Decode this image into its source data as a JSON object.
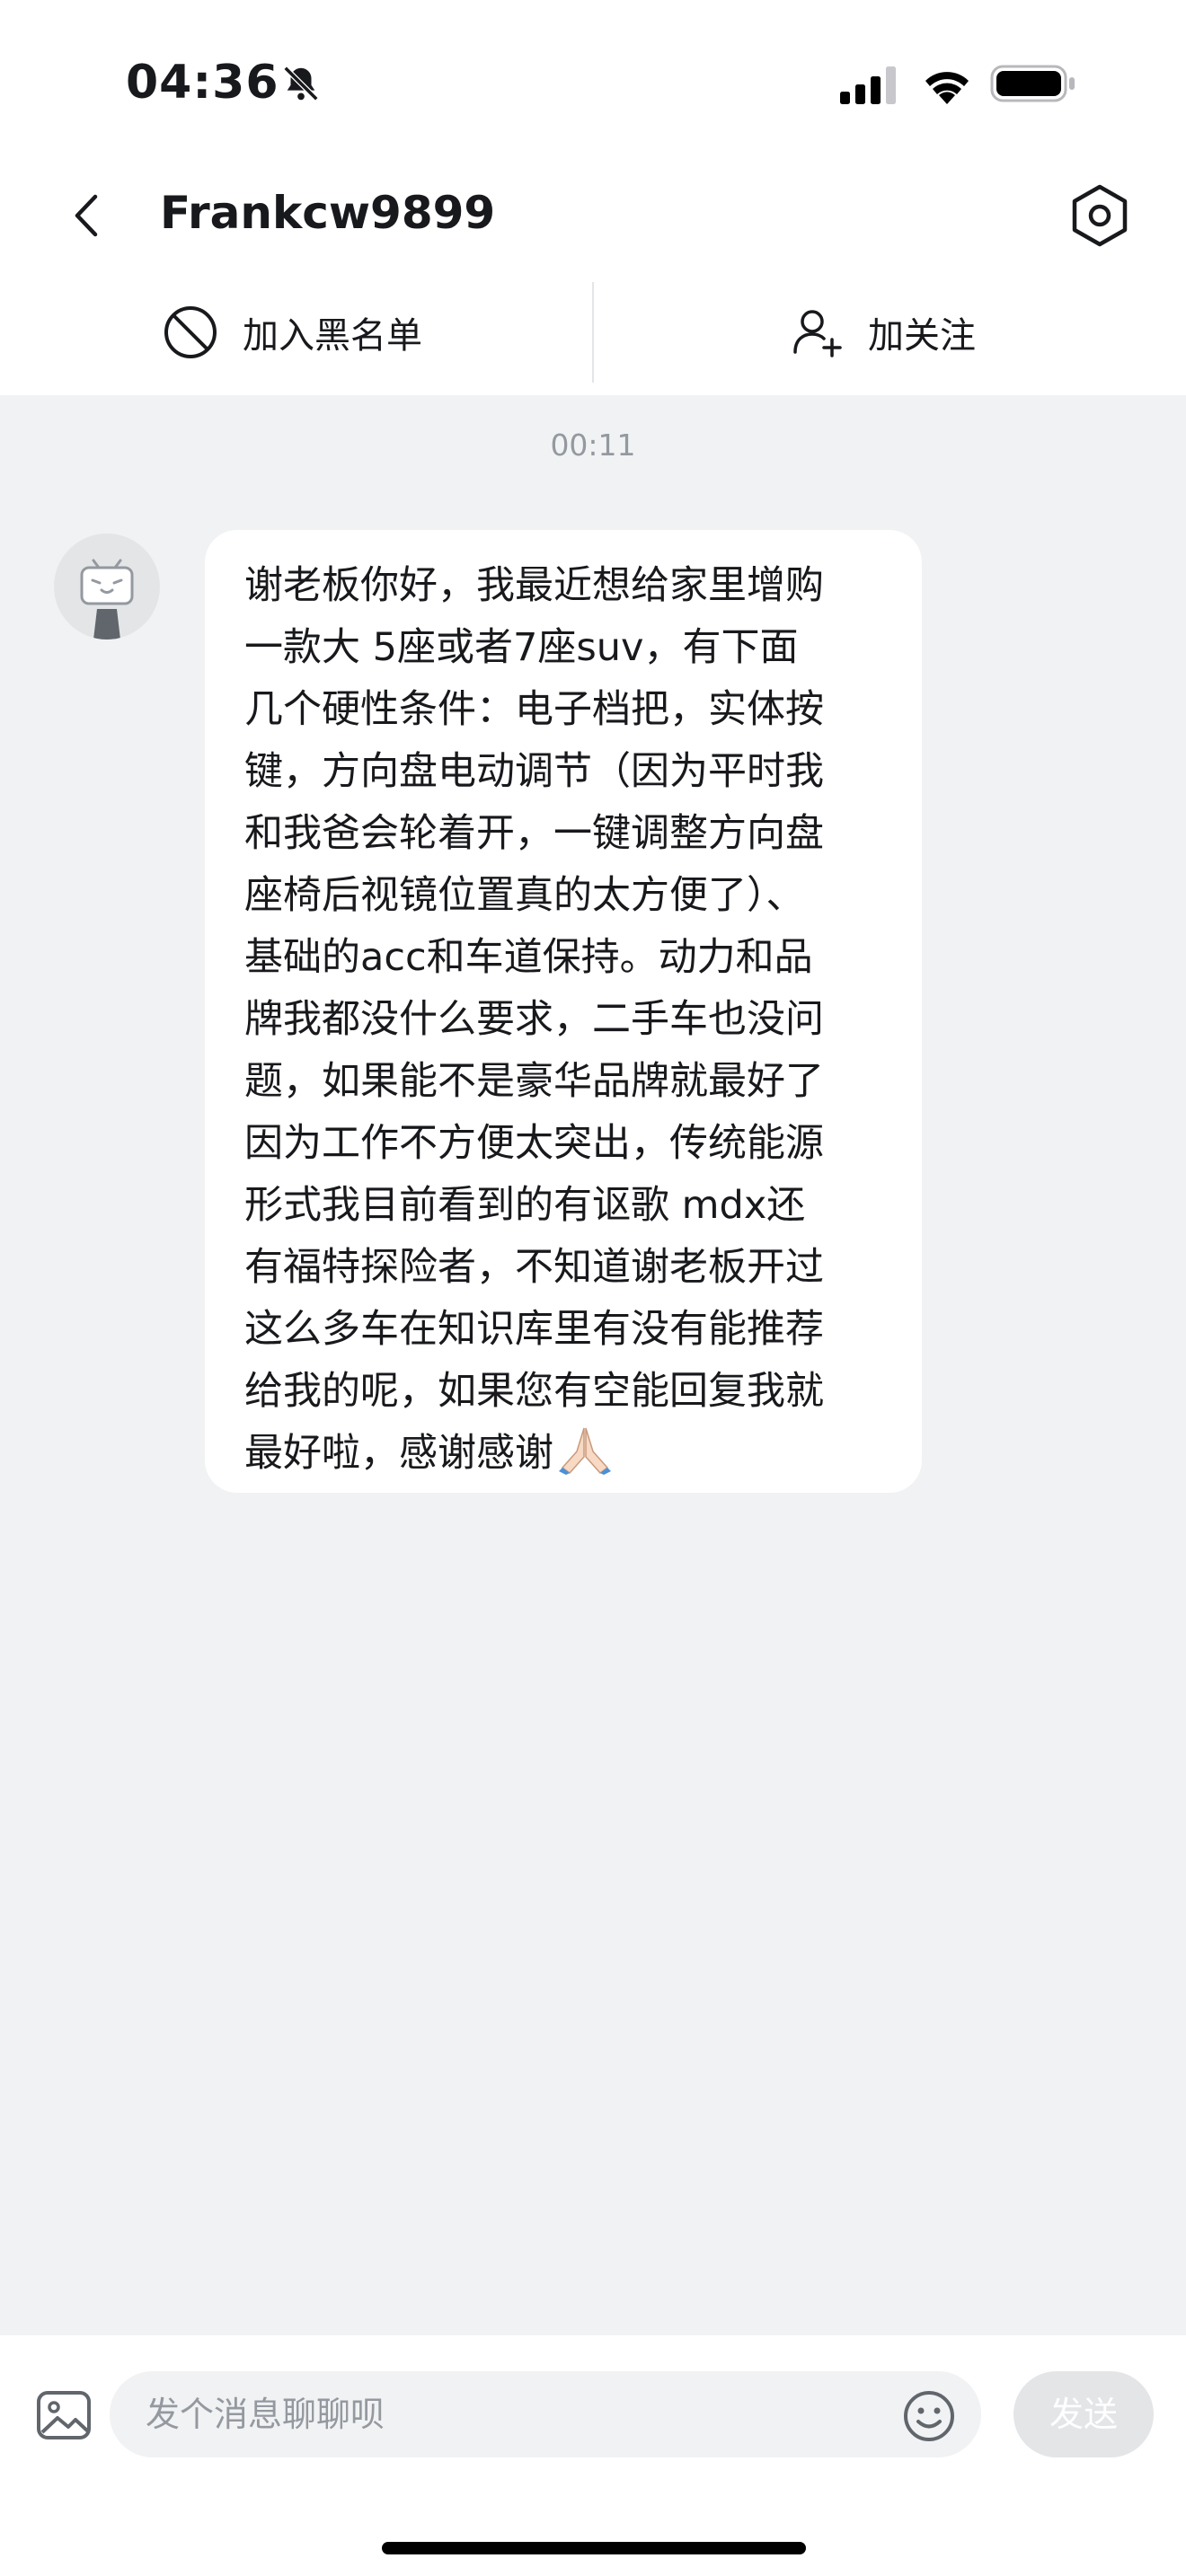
{
  "status_bar": {
    "time": "04:36",
    "bell_icon": "bell-slash-icon",
    "signal_icon": "cellular-signal-icon",
    "wifi_icon": "wifi-icon",
    "battery_icon": "battery-icon"
  },
  "header": {
    "title": "Frankcw9899",
    "back_icon": "chevron-left-icon",
    "settings_icon": "hexagon-gear-icon"
  },
  "actions": {
    "block": {
      "label": "加入黑名单",
      "icon": "block-circle-icon"
    },
    "follow": {
      "label": "加关注",
      "icon": "user-plus-icon"
    }
  },
  "chat": {
    "timestamp": "00:11",
    "message": {
      "lines": [
        "谢老板你好，我最近想给家里增购",
        "一款大 5座或者7座suv，有下面",
        "几个硬性条件：电子档把，实体按",
        "键，方向盘电动调节（因为平时我",
        "和我爸会轮着开，一键调整方向盘",
        "座椅后视镜位置真的太方便了）、",
        "基础的acc和车道保持。动力和品",
        "牌我都没什么要求，二手车也没问",
        "题，如果能不是豪华品牌就最好了",
        "因为工作不方便太突出，传统能源",
        "形式我目前看到的有讴歌 mdx还",
        "有福特探险者，不知道谢老板开过",
        "这么多车在知识库里有没有能推荐",
        "给我的呢，如果您有空能回复我就",
        "最好啦，感谢感谢"
      ],
      "emoji": "praying-hands-icon"
    }
  },
  "footer": {
    "placeholder": "发个消息聊聊呗",
    "send_label": "发送",
    "image_icon": "image-icon",
    "emoji_icon": "smiley-icon"
  },
  "colors": {
    "background": "#f1f2f3",
    "text": "#18191c",
    "muted": "#9499a0",
    "send_disabled": "#e3e5e7"
  }
}
